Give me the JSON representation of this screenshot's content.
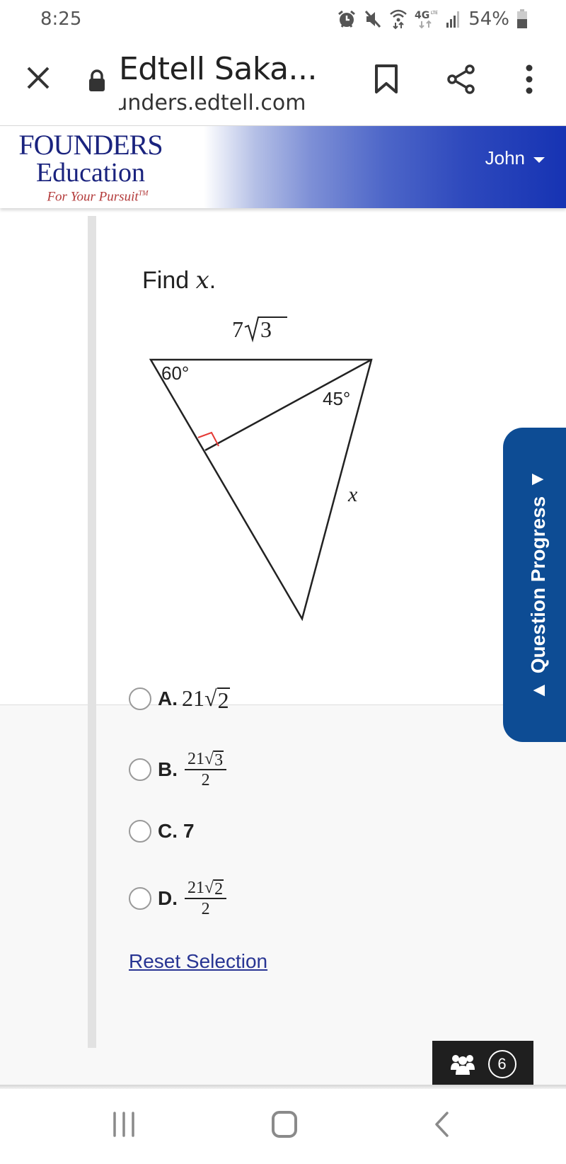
{
  "status_bar": {
    "time": "8:25",
    "network": "4G",
    "battery_percent": "54%",
    "icons": [
      "alarm-icon",
      "mute-icon",
      "wifi-icon",
      "4g-icon",
      "signal-icon",
      "battery-icon"
    ]
  },
  "browser": {
    "close_icon": "close-icon",
    "lock_icon": "lock-icon",
    "title": "Edtell Saka...",
    "url": "ɹnders.edtell.com",
    "bookmark_icon": "bookmark-icon",
    "share_icon": "share-icon",
    "menu_icon": "more-vert-icon"
  },
  "site_header": {
    "logo_line1": "FOUNDERS",
    "logo_line2": "Education",
    "logo_tagline": "For Your Pursuit",
    "logo_tm": "TM",
    "user_name": "John",
    "accent_color": "#1633b3"
  },
  "question": {
    "prompt_prefix": "Find ",
    "prompt_var": "x",
    "prompt_suffix": ".",
    "figure": {
      "top_side_coef": "7",
      "top_side_radicand": "3",
      "angle_left": "60°",
      "angle_right": "45°",
      "side_label": "x",
      "right_angle_color": "#e53935"
    }
  },
  "choices": [
    {
      "letter": "A.",
      "type": "radical",
      "coef": "21",
      "radicand": "2"
    },
    {
      "letter": "B.",
      "type": "fraction",
      "coef": "21",
      "radicand": "3",
      "denominator": "2"
    },
    {
      "letter": "C.",
      "type": "plain",
      "value": "7"
    },
    {
      "letter": "D.",
      "type": "fraction",
      "coef": "21",
      "radicand": "2",
      "denominator": "2"
    }
  ],
  "reset_label": "Reset Selection",
  "question_progress": {
    "label": "Question Progress",
    "color": "#0d4c94"
  },
  "participants": {
    "icon": "group-icon",
    "count": "6"
  },
  "nav_bar": {
    "recents_icon": "recents-icon",
    "home_icon": "home-icon",
    "back_icon": "back-icon"
  }
}
